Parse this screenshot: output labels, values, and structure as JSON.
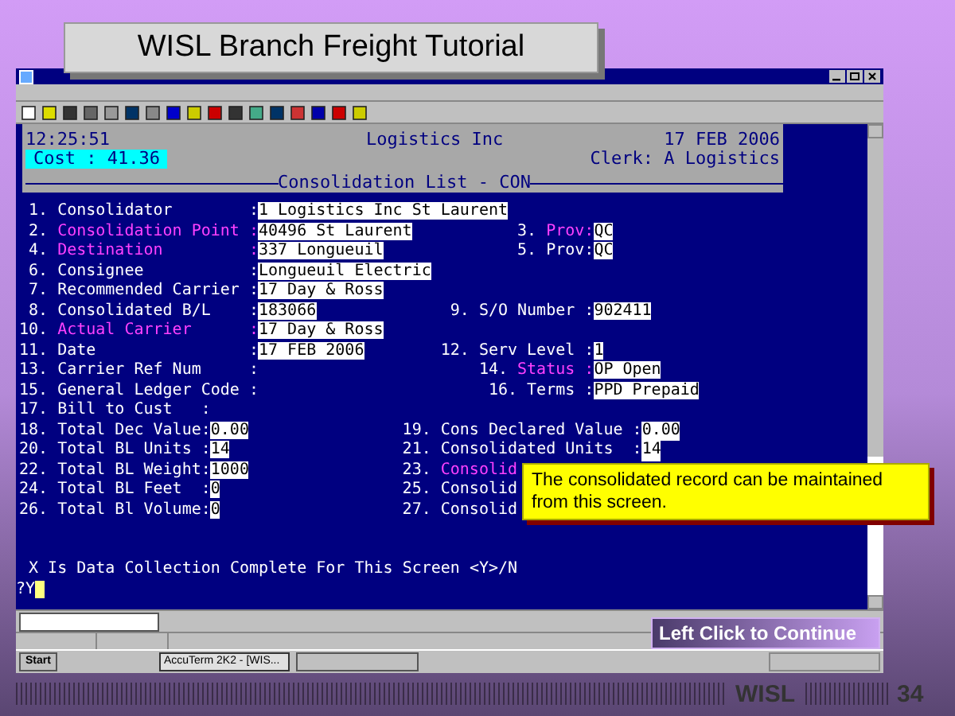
{
  "slide": {
    "title": "WISL Branch Freight Tutorial",
    "callout": "The consolidated record can be maintained from this screen.",
    "continue_button": "Left Click to Continue",
    "footer": "WISL",
    "page": "34"
  },
  "terminal": {
    "time": "12:25:51",
    "company": "Logistics Inc",
    "date": "17 FEB 2006",
    "cost": "Cost : 41.36",
    "clerk": "Clerk: A Logistics",
    "screen_title": "Consolidation List - CON",
    "fields": [
      {
        "num": "1.",
        "label": "Consolidator        :",
        "highlight": false,
        "value": "1 Logistics Inc St Laurent"
      },
      {
        "num": "2.",
        "label": "Consolidation Point :",
        "highlight": true,
        "value": "40496 St Laurent",
        "right": {
          "num": "3.",
          "label": "Prov:",
          "highlight": true,
          "value": "QC"
        }
      },
      {
        "num": "4.",
        "label": "Destination         :",
        "highlight": true,
        "value": "337 Longueuil",
        "right": {
          "num": "5.",
          "label": "Prov:",
          "highlight": false,
          "value": "QC"
        }
      },
      {
        "num": "6.",
        "label": "Consignee           :",
        "highlight": false,
        "value": "Longueuil Electric"
      },
      {
        "num": "7.",
        "label": "Recommended Carrier :",
        "highlight": false,
        "value": "17 Day & Ross"
      },
      {
        "num": "8.",
        "label": "Consolidated B/L    :",
        "highlight": false,
        "value": "183066",
        "right": {
          "num": "9.",
          "label": "S/O Number :",
          "highlight": false,
          "value": "902411"
        }
      },
      {
        "num": "10.",
        "label": "Actual Carrier      :",
        "highlight": true,
        "value": "17 Day & Ross"
      },
      {
        "num": "11.",
        "label": "Date                :",
        "highlight": false,
        "value": "17 FEB 2006",
        "right": {
          "num": "12.",
          "label": "Serv Level :",
          "highlight": false,
          "value": "1"
        }
      },
      {
        "num": "13.",
        "label": "Carrier Ref Num     :",
        "highlight": false,
        "right": {
          "num": "14.",
          "label": "Status :",
          "highlight": true,
          "value": "OP Open"
        }
      },
      {
        "num": "15.",
        "label": "General Ledger Code :",
        "highlight": false,
        "right": {
          "num": "16.",
          "label": "Terms :",
          "highlight": false,
          "value": "PPD Prepaid"
        }
      },
      {
        "num": "17.",
        "label": "Bill to Cust   :",
        "highlight": false
      }
    ],
    "totals": [
      {
        "num": "18.",
        "label": "Total Dec Value:",
        "highlight": false,
        "value": "0.00",
        "right": {
          "num": "19.",
          "label": "Cons Declared Value :",
          "highlight": false,
          "value": "0.00"
        }
      },
      {
        "num": "20.",
        "label": "Total BL Units :",
        "highlight": false,
        "value": "14",
        "right": {
          "num": "21.",
          "label": "Consolidated Units  :",
          "highlight": false,
          "value": "14"
        }
      },
      {
        "num": "22.",
        "label": "Total BL Weight:",
        "highlight": false,
        "value": "1000",
        "right": {
          "num": "23.",
          "label": "Consolid",
          "highlight": true
        }
      },
      {
        "num": "24.",
        "label": "Total BL Feet  :",
        "highlight": false,
        "value": "0",
        "right": {
          "num": "25.",
          "label": "Consolid",
          "highlight": false
        }
      },
      {
        "num": "26.",
        "label": "Total Bl Volume:",
        "highlight": false,
        "value": "0",
        "right": {
          "num": "27.",
          "label": "Consolid",
          "highlight": false
        }
      }
    ],
    "prompt": " X Is Data Collection Complete For This Screen <Y>/N",
    "input": "?Y"
  },
  "taskbar": {
    "start": "Start",
    "task": "AccuTerm 2K2 - [WIS..."
  }
}
